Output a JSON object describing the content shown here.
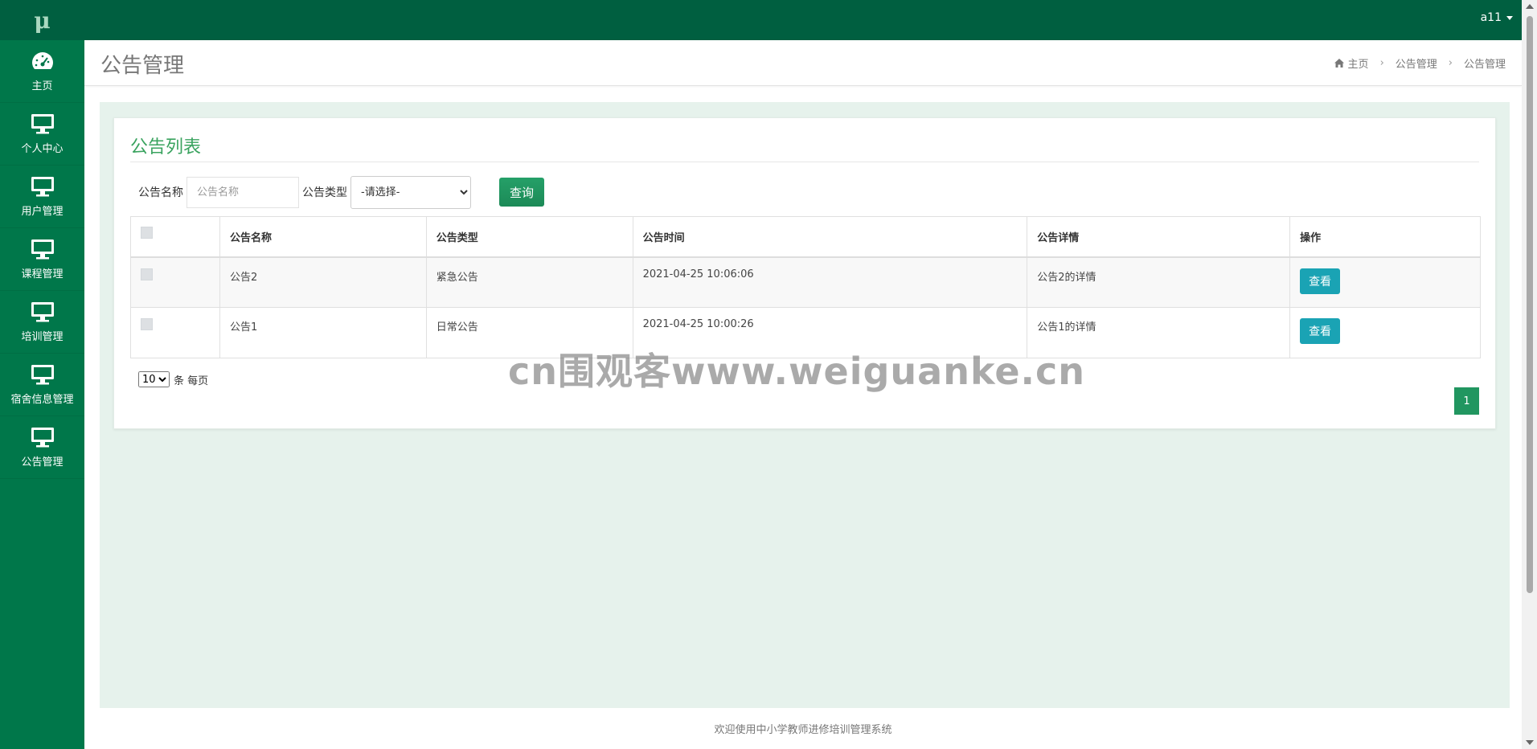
{
  "sidebar": {
    "logo": "μ",
    "items": [
      {
        "label": "主页",
        "icon": "dashboard-icon"
      },
      {
        "label": "个人中心",
        "icon": "monitor-icon"
      },
      {
        "label": "用户管理",
        "icon": "monitor-icon"
      },
      {
        "label": "课程管理",
        "icon": "monitor-icon"
      },
      {
        "label": "培训管理",
        "icon": "monitor-icon"
      },
      {
        "label": "宿舍信息管理",
        "icon": "monitor-icon"
      },
      {
        "label": "公告管理",
        "icon": "monitor-icon"
      }
    ]
  },
  "topbar": {
    "username": "a11"
  },
  "page_header": {
    "title": "公告管理",
    "breadcrumb": [
      "主页",
      "公告管理",
      "公告管理"
    ]
  },
  "card": {
    "title": "公告列表",
    "search": {
      "name_label": "公告名称",
      "name_placeholder": "公告名称",
      "type_label": "公告类型",
      "type_selected": "-请选择-",
      "button_label": "查询"
    },
    "table": {
      "headers": [
        "公告名称",
        "公告类型",
        "公告时间",
        "公告详情",
        "操作"
      ],
      "rows": [
        {
          "name": "公告2",
          "type": "紧急公告",
          "time": "2021-04-25 10:06:06",
          "detail": "公告2的详情",
          "action": "查看"
        },
        {
          "name": "公告1",
          "type": "日常公告",
          "time": "2021-04-25 10:00:26",
          "detail": "公告1的详情",
          "action": "查看"
        }
      ]
    },
    "pager": {
      "page_size": "10",
      "per_page_label": "条 每页",
      "current_page": "1"
    }
  },
  "watermark": "cn围观客www.weiguanke.cn",
  "footer": {
    "text": "欢迎使用中小学教师进修培训管理系统"
  },
  "colors": {
    "sidebar": "#00774a",
    "topbar": "#005f40",
    "accent": "#219660",
    "view_button": "#1aa3b4",
    "content_bg": "#e6f2ec"
  }
}
